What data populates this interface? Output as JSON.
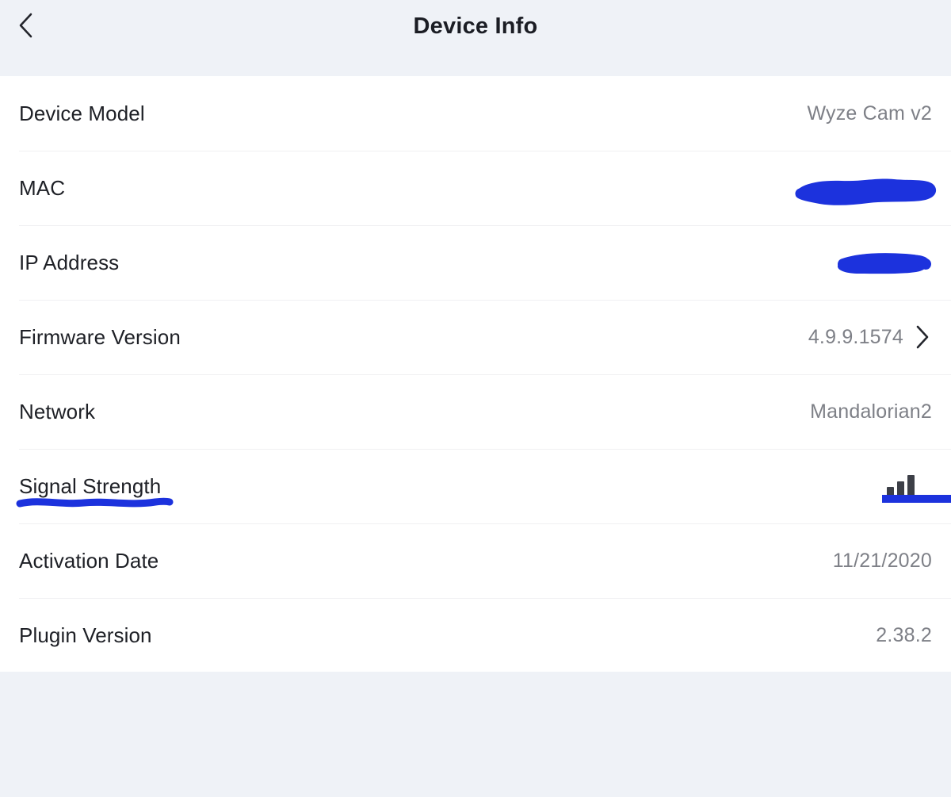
{
  "header": {
    "title": "Device Info",
    "back_icon": "chevron-left-icon"
  },
  "colors": {
    "page_background": "#eff2f7",
    "panel_background": "#ffffff",
    "label_text": "#1e2026",
    "value_text": "#7e8087",
    "divider": "#f0f0f2",
    "annotation_blue": "#1c32dd",
    "signal_bar": "#3c3f47"
  },
  "rows": [
    {
      "label": "Device Model",
      "value": "Wyze Cam v2",
      "type": "text"
    },
    {
      "label": "MAC",
      "value": "",
      "type": "redacted",
      "annotation": "blue-scribble-redaction"
    },
    {
      "label": "IP Address",
      "value": "",
      "type": "redacted",
      "annotation": "blue-scribble-redaction"
    },
    {
      "label": "Firmware Version",
      "value": "4.9.9.1574",
      "type": "text-with-chevron",
      "accessory_icon": "chevron-right-icon"
    },
    {
      "label": "Network",
      "value": "Mandalorian2",
      "type": "text"
    },
    {
      "label": "Signal Strength",
      "value": "",
      "type": "signal-bars",
      "bars_total": 3,
      "bars_filled": 3,
      "annotation": "blue-underline-on-label-and-value"
    },
    {
      "label": "Activation Date",
      "value": "11/21/2020",
      "type": "text"
    },
    {
      "label": "Plugin Version",
      "value": "2.38.2",
      "type": "text"
    }
  ]
}
